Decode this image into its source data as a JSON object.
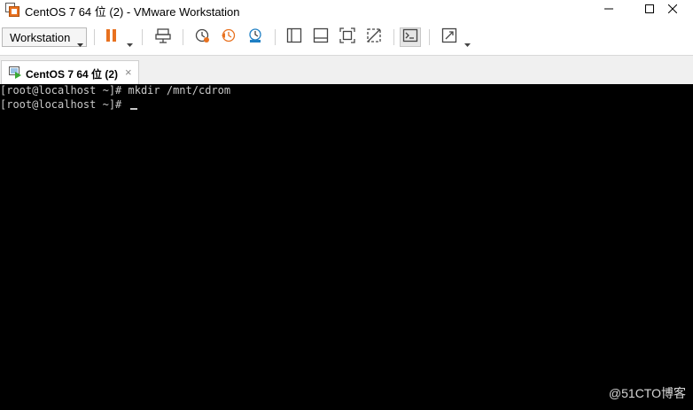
{
  "window": {
    "title": "CentOS 7 64 位 (2) - VMware Workstation",
    "minimize": "minimize-icon",
    "maximize": "maximize-icon",
    "close": "close-icon"
  },
  "toolbar": {
    "workstation_menu_label": "Workstation",
    "accent_color": "#e8711f",
    "buttons": [
      "pause-icon",
      "send-ctrl-alt-del-icon",
      "snapshot-icon",
      "revert-snapshot-icon",
      "snapshot-manager-icon",
      "show-library-icon",
      "show-thumbnail-bar-icon",
      "fullscreen-icon",
      "unity-icon",
      "console-view-icon",
      "stretch-guest-icon"
    ]
  },
  "tabs": [
    {
      "label": "CentOS 7 64 位 (2)",
      "close": "×",
      "active": true
    }
  ],
  "console": {
    "lines": [
      "[root@localhost ~]# mkdir /mnt/cdrom",
      "[root@localhost ~]# "
    ]
  },
  "watermark": "@51CTO博客"
}
